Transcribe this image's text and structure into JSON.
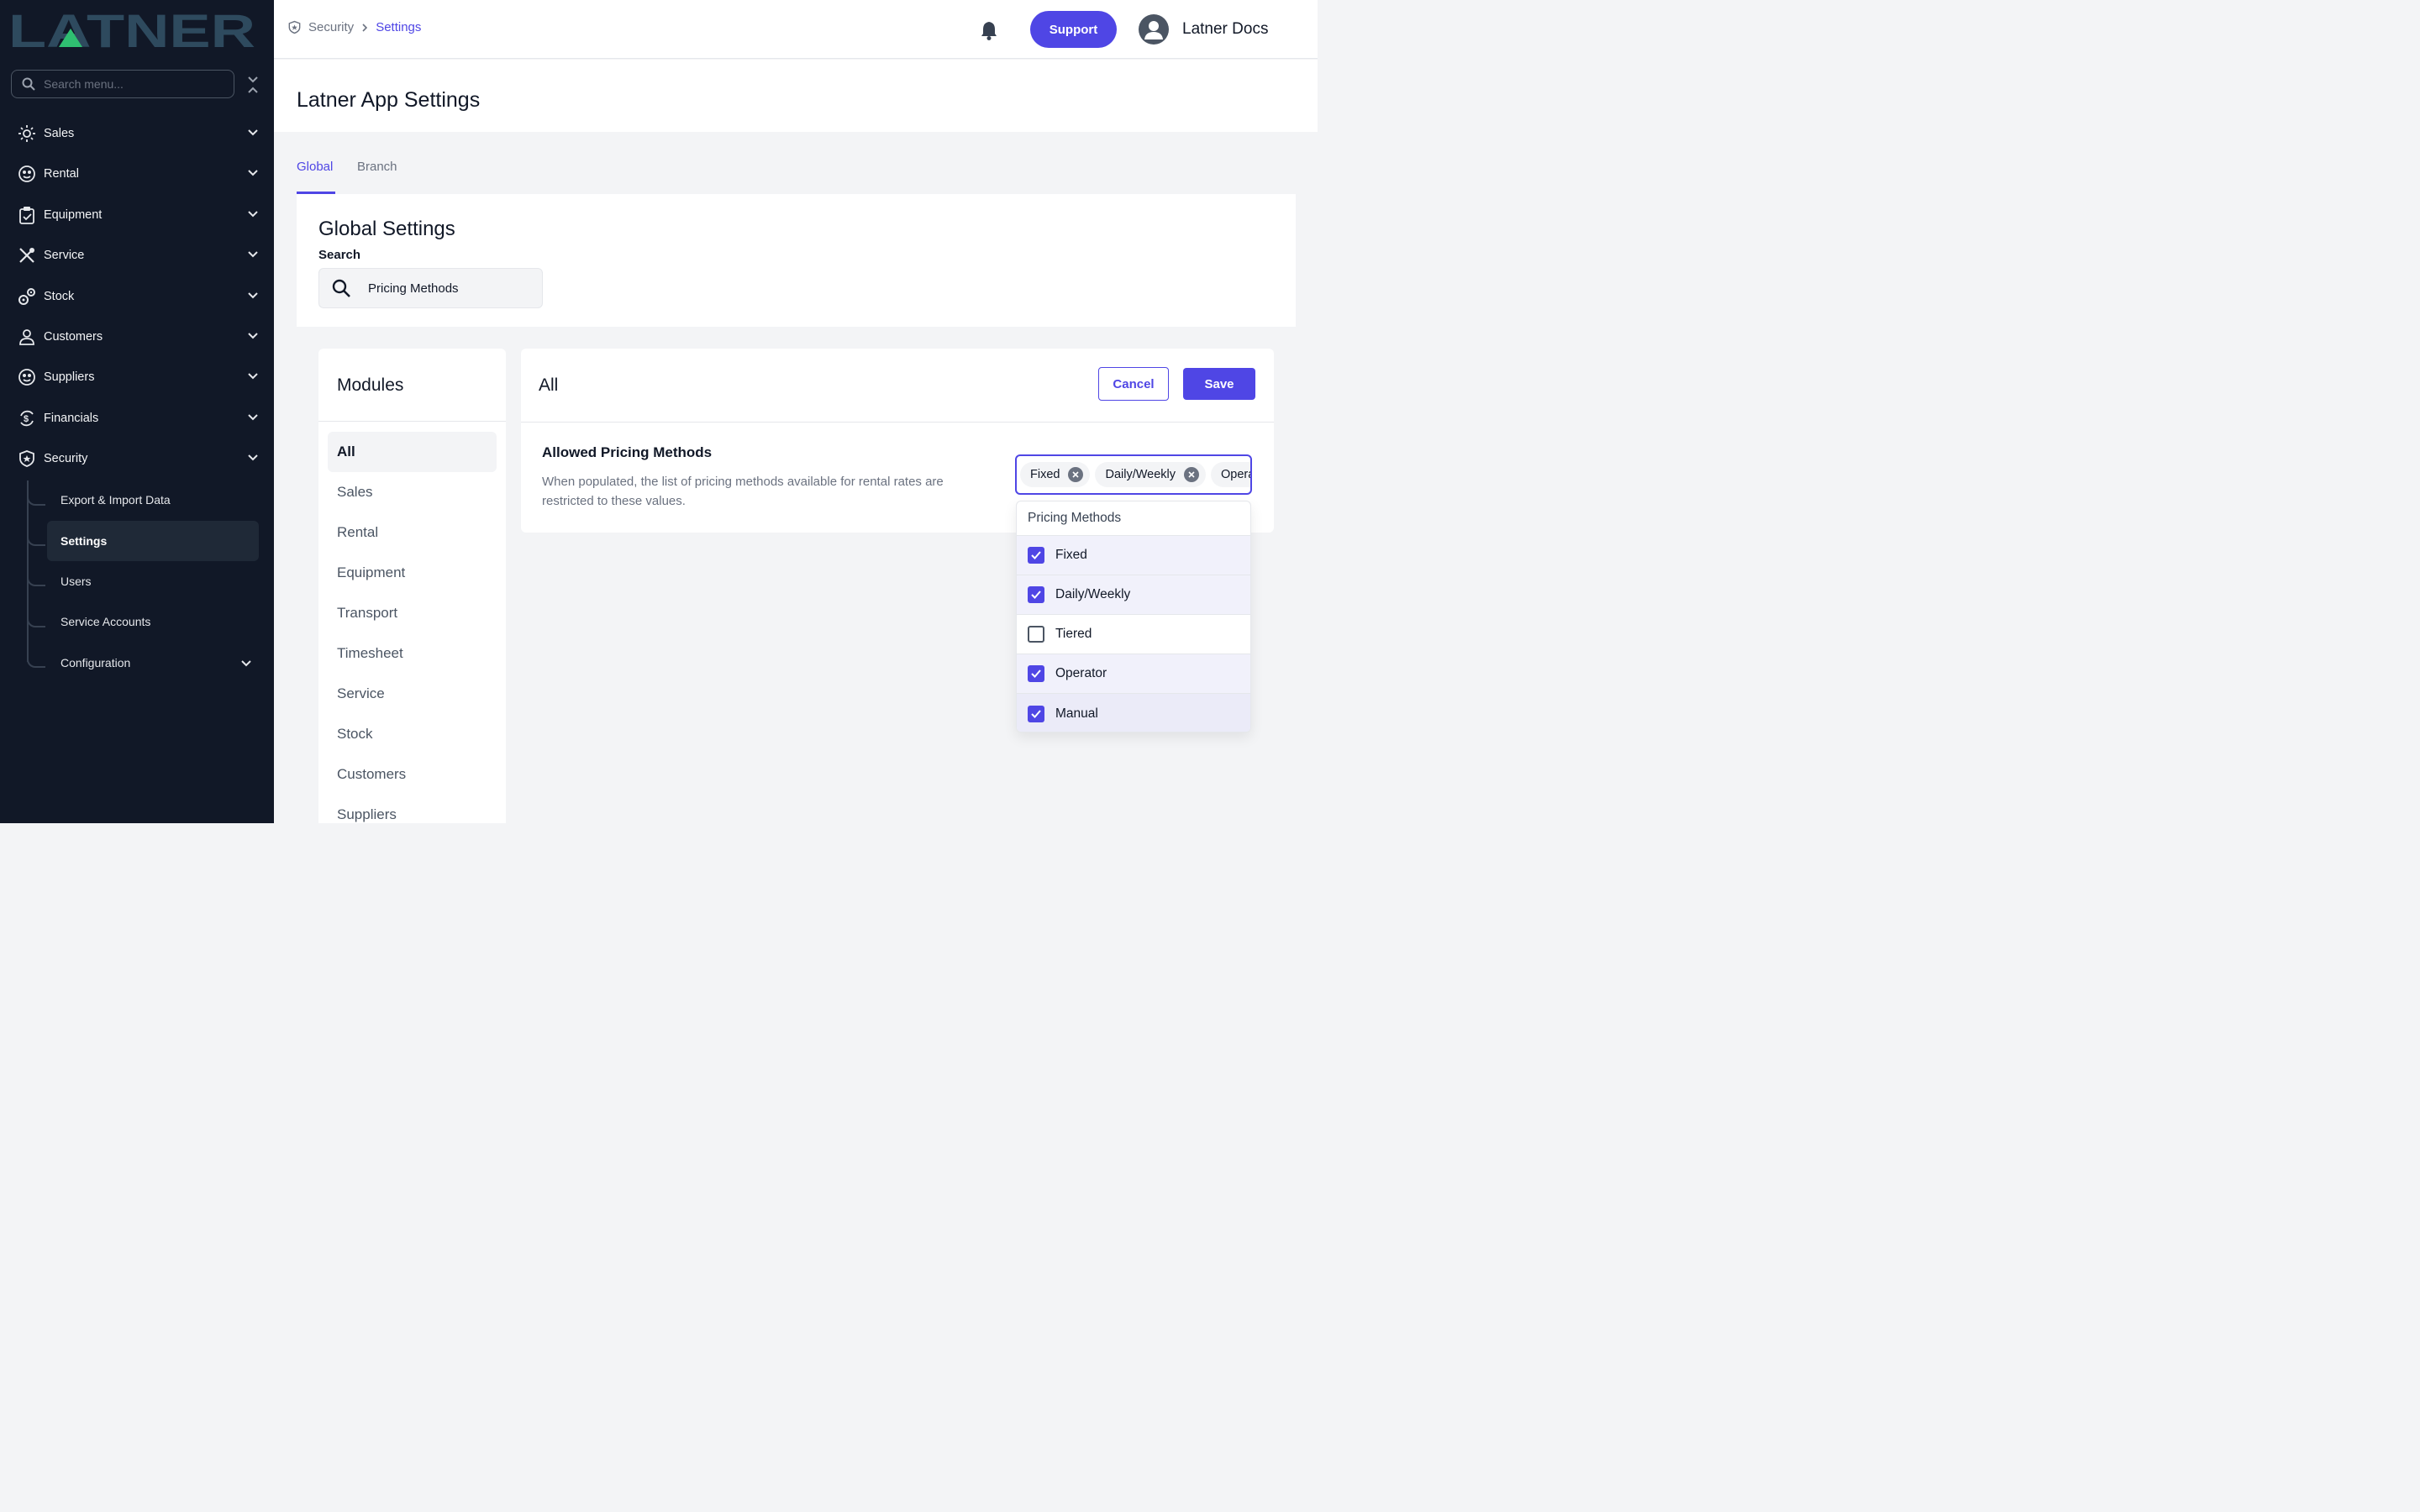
{
  "brand": {
    "logo_text": "LATNER",
    "logo_color": "#2e4a5e",
    "accent": "#2fbf71"
  },
  "sidebar": {
    "search_placeholder": "Search menu...",
    "items": [
      {
        "label": "Sales",
        "icon": "sales-icon"
      },
      {
        "label": "Rental",
        "icon": "rental-icon"
      },
      {
        "label": "Equipment",
        "icon": "clipboard-icon"
      },
      {
        "label": "Service",
        "icon": "tools-icon"
      },
      {
        "label": "Stock",
        "icon": "gears-icon"
      },
      {
        "label": "Customers",
        "icon": "user-icon"
      },
      {
        "label": "Suppliers",
        "icon": "suppliers-icon"
      },
      {
        "label": "Financials",
        "icon": "dollar-cycle-icon"
      },
      {
        "label": "Security",
        "icon": "shield-icon"
      }
    ],
    "security_sub": [
      {
        "label": "Export & Import Data"
      },
      {
        "label": "Settings"
      },
      {
        "label": "Users"
      },
      {
        "label": "Service Accounts"
      },
      {
        "label": "Configuration"
      }
    ]
  },
  "topbar": {
    "breadcrumb": [
      "Security",
      "Settings"
    ],
    "support_label": "Support",
    "user_name": "Latner Docs"
  },
  "page": {
    "title": "Latner App Settings"
  },
  "tabs": [
    "Global",
    "Branch"
  ],
  "global_settings": {
    "title": "Global Settings",
    "search_label": "Search",
    "search_value": "Pricing Methods"
  },
  "modules": {
    "title": "Modules",
    "items": [
      "All",
      "Sales",
      "Rental",
      "Equipment",
      "Transport",
      "Timesheet",
      "Service",
      "Stock",
      "Customers",
      "Suppliers"
    ]
  },
  "card": {
    "title": "All",
    "cancel_label": "Cancel",
    "save_label": "Save",
    "setting_name": "Allowed Pricing Methods",
    "setting_desc": "When populated, the list of pricing methods available for rental rates are restricted to these values.",
    "chips": [
      "Fixed",
      "Daily/Weekly",
      "Operator"
    ]
  },
  "dropdown": {
    "header": "Pricing Methods",
    "options": [
      {
        "label": "Fixed",
        "checked": true
      },
      {
        "label": "Daily/Weekly",
        "checked": true
      },
      {
        "label": "Tiered",
        "checked": false
      },
      {
        "label": "Operator",
        "checked": true
      },
      {
        "label": "Manual",
        "checked": true
      }
    ]
  },
  "colors": {
    "primary": "#4f46e5",
    "sidebar_bg": "#111827"
  }
}
